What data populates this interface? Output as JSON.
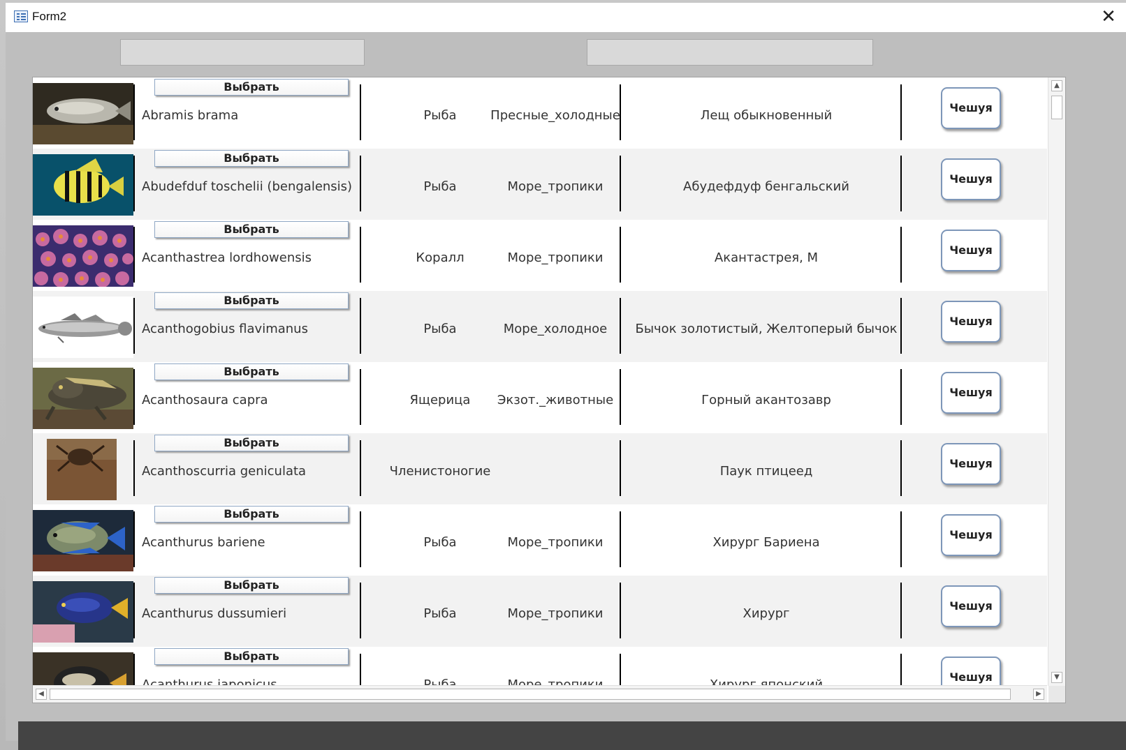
{
  "window": {
    "title": "Form2",
    "close_glyph": "✕"
  },
  "list": {
    "rows": [
      {
        "select_label": "Выбрать",
        "latin": "Abramis brama",
        "type": "Рыба",
        "habitat": "Пресные_холодные",
        "russian_name": "Лещ обыкновенный",
        "scale_label": "Чешуя"
      },
      {
        "select_label": "Выбрать",
        "latin": "Abudefduf toschelii (bengalensis)",
        "type": "Рыба",
        "habitat": "Море_тропики",
        "russian_name": "Абудефдуф бенгальский",
        "scale_label": "Чешуя"
      },
      {
        "select_label": "Выбрать",
        "latin": "Acanthastrea lordhowensis",
        "type": "Коралл",
        "habitat": "Море_тропики",
        "russian_name": "Акантастрея, М",
        "scale_label": "Чешуя"
      },
      {
        "select_label": "Выбрать",
        "latin": "Acanthogobius flavimanus",
        "type": "Рыба",
        "habitat": "Море_холодное",
        "russian_name": "Бычок золотистый, Желтоперый бычок",
        "scale_label": "Чешуя"
      },
      {
        "select_label": "Выбрать",
        "latin": "Acanthosaura capra",
        "type": "Ящерица",
        "habitat": "Экзот._животные",
        "russian_name": "Горный акантозавр",
        "scale_label": "Чешуя"
      },
      {
        "select_label": "Выбрать",
        "latin": "Acanthoscurria geniculata",
        "type": "Членистоногие",
        "habitat": "",
        "russian_name": "Паук птицеед",
        "scale_label": "Чешуя"
      },
      {
        "select_label": "Выбрать",
        "latin": "Acanthurus bariene",
        "type": "Рыба",
        "habitat": "Море_тропики",
        "russian_name": "Хирург Бариена",
        "scale_label": "Чешуя"
      },
      {
        "select_label": "Выбрать",
        "latin": "Acanthurus dussumieri",
        "type": "Рыба",
        "habitat": "Море_тропики",
        "russian_name": "Хирург",
        "scale_label": "Чешуя"
      },
      {
        "select_label": "Выбрать",
        "latin": "Acanthurus japonicus",
        "type": "Рыба",
        "habitat": "Море_тропики",
        "russian_name": "Хирург японский",
        "scale_label": "Чешуя"
      }
    ]
  },
  "scrollbars": {
    "up_glyph": "▲",
    "down_glyph": "▼",
    "left_glyph": "◀",
    "right_glyph": "▶"
  }
}
